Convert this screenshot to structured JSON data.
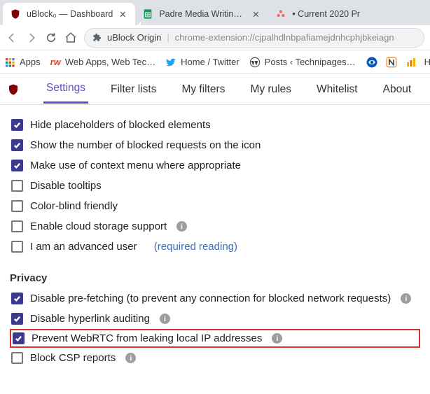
{
  "tabs": [
    {
      "title": "uBlock₀ — Dashboard",
      "active": true,
      "favicon": "ublock"
    },
    {
      "title": "Padre Media Writing - Google Sh",
      "active": false,
      "favicon": "sheets"
    },
    {
      "title": "• Current 2020 Pr",
      "active": false,
      "favicon": "asana"
    }
  ],
  "omnibox": {
    "ext_name": "uBlock Origin",
    "path": "chrome-extension://cjpalhdlnbpafiamejdnhcphjbkeiagn"
  },
  "bookmarks": {
    "apps": "Apps",
    "webapps": "Web Apps, Web Tec…",
    "twitter": "Home / Twitter",
    "technipages": "Posts ‹ Technipages…",
    "hor": "Hor"
  },
  "dashboard_tabs": {
    "settings": "Settings",
    "filter_lists": "Filter lists",
    "my_filters": "My filters",
    "my_rules": "My rules",
    "whitelist": "Whitelist",
    "about": "About"
  },
  "settings": {
    "hide_placeholders": "Hide placeholders of blocked elements",
    "show_blocked_count": "Show the number of blocked requests on the icon",
    "context_menu": "Make use of context menu where appropriate",
    "disable_tooltips": "Disable tooltips",
    "color_blind": "Color-blind friendly",
    "cloud_storage": "Enable cloud storage support",
    "advanced_user": "I am an advanced user",
    "required_reading": "(required reading)"
  },
  "privacy": {
    "heading": "Privacy",
    "prefetch": "Disable pre-fetching (to prevent any connection for blocked network requests)",
    "hyperlink_audit": "Disable hyperlink auditing",
    "webrtc": "Prevent WebRTC from leaking local IP addresses",
    "csp": "Block CSP reports"
  }
}
